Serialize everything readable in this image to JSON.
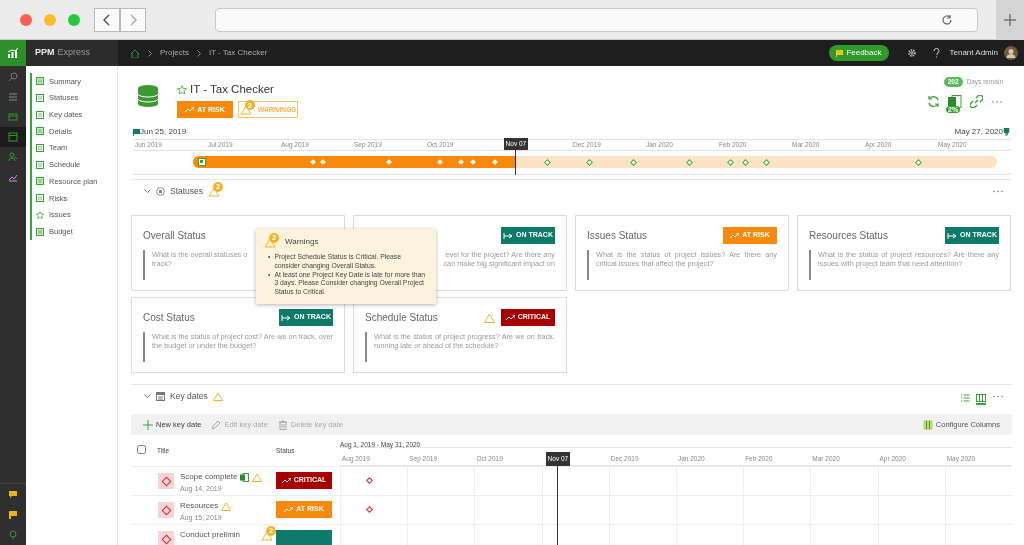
{
  "brand": {
    "name": "PPM",
    "suffix": "Express"
  },
  "breadcrumb": [
    "Projects",
    "IT - Tax Checker"
  ],
  "topbar": {
    "feedback": "Feedback",
    "user": "Tenant Admin"
  },
  "sidebar": {
    "items": [
      {
        "label": "Summary"
      },
      {
        "label": "Statuses"
      },
      {
        "label": "Key dates"
      },
      {
        "label": "Details"
      },
      {
        "label": "Team"
      },
      {
        "label": "Schedule"
      },
      {
        "label": "Resource plan"
      },
      {
        "label": "Risks"
      },
      {
        "label": "Issues"
      },
      {
        "label": "Budget"
      }
    ]
  },
  "project": {
    "title": "IT - Tax Checker",
    "status": {
      "kind": "at_risk",
      "label": "AT RISK"
    },
    "warnings": {
      "label": "WARNINGS",
      "count": "2"
    },
    "days_remaining": {
      "value": "202",
      "label": "Days remain"
    },
    "progress_badge": "2%"
  },
  "timeline": {
    "start": "Jun 25, 2019",
    "end": "May 27, 2020",
    "months": [
      "Jun 2019",
      "Jul 2019",
      "Aug 2019",
      "Sep 2019",
      "Oct 2019",
      "Dec 2019",
      "Jan 2020",
      "Feb 2020",
      "Mar 2020",
      "Apr 2020",
      "May 2020"
    ],
    "today": "Nov 07",
    "level": 0.4
  },
  "statuses": {
    "title": "Statuses",
    "warning_count": "2",
    "cards": [
      {
        "title": "Overall Status",
        "description_lines": [
          "What is the overall statuses o",
          "track?"
        ]
      },
      {
        "status": {
          "kind": "on_track",
          "label": "ON TRACK"
        },
        "description_lines": [
          "evel for the project? Are there any",
          "can make big significant impact on"
        ]
      },
      {
        "title": "Issues Status",
        "status": {
          "kind": "at_risk",
          "label": "AT RISK"
        },
        "description": "What is the status of project issues? Are there any critical issues that affect the project?"
      },
      {
        "title": "Resources Status",
        "status": {
          "kind": "on_track",
          "label": "ON TRACK"
        },
        "description": "What is the status of project resources? Are there any issues with project team that need attention?"
      },
      {
        "title": "Cost Status",
        "status": {
          "kind": "on_track",
          "label": "ON TRACK"
        },
        "description": "What is the status of project cost? Are we on track, over the budget or under the budget?"
      },
      {
        "title": "Schedule Status",
        "warning": true,
        "status": {
          "kind": "critical",
          "label": "CRITICAL"
        },
        "description": "What is the status of project progress? Are we on track, running late or ahead of the schedule?"
      }
    ],
    "popup": {
      "title": "Warnings",
      "count": "2",
      "items": [
        {
          "bullet": "•",
          "text": "Project Schedule Status is Critical. Please consider changing Overall Status."
        },
        {
          "bullet": "•",
          "text": "At least one Project Key Date is late for more than 3 days. Please Consider changing Overall Project Status to Critical."
        }
      ]
    }
  },
  "key_dates": {
    "title": "Key dates",
    "views": [
      {
        "selected": false
      },
      {
        "selected": true
      }
    ],
    "toolbar": [
      {
        "label": "New key date",
        "disabled": false
      },
      {
        "label": "Edit key date",
        "disabled": true
      },
      {
        "label": "Delete key date",
        "disabled": true
      }
    ],
    "configure": "Configure Columns",
    "select_all": {
      "checked": false
    },
    "columns": [
      "Title",
      "Status"
    ],
    "range": "Aug 1, 2019 - May 31, 2020",
    "months": [
      "Aug 2019",
      "Sep 2019",
      "Oct 2019",
      "Dec 2019",
      "Jan 2020",
      "Feb 2020",
      "Mar 2020",
      "Apr 2020",
      "May 2020"
    ],
    "today": "Nov 07",
    "rows": [
      {
        "title": "Scope complete",
        "date": "Aug 14, 2019",
        "synced": true,
        "warning": true,
        "status": {
          "kind": "critical",
          "label": "CRITICAL"
        }
      },
      {
        "title": "Resources",
        "date": "Aug 15, 2019",
        "warning": true,
        "status": {
          "kind": "at_risk",
          "label": "AT RISK"
        }
      },
      {
        "title": "Conduct prelimin",
        "warning_count": "2",
        "status": {
          "kind": "on_track"
        }
      }
    ]
  }
}
